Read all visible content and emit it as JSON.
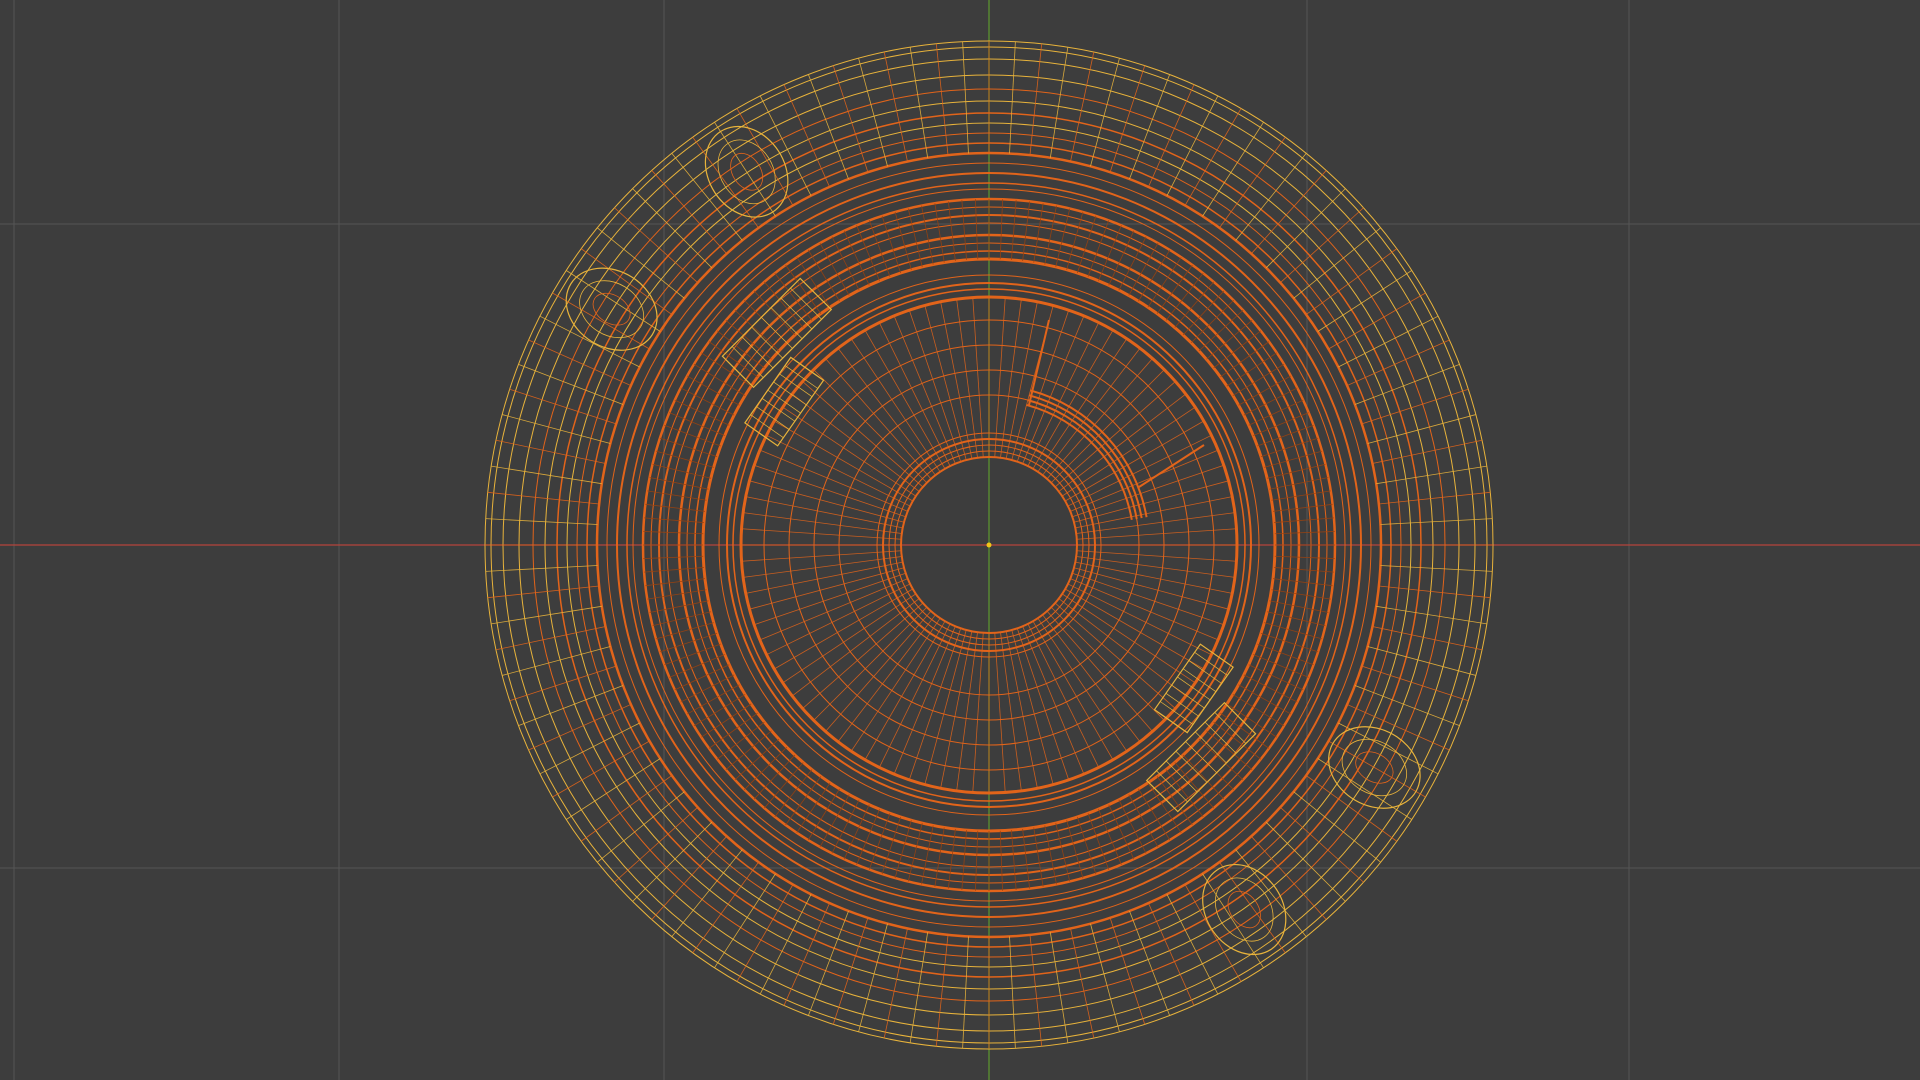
{
  "viewport": {
    "background": "#3d3d3d",
    "grid_color": "#555555",
    "x_axis_color": "#b5443c",
    "y_axis_color": "#5d9a2e",
    "origin_color": "#f0c419"
  },
  "object": {
    "display": "wireframe",
    "selected": true,
    "active_outline_color": "#e8b33b",
    "selected_wire_color": "#e2641a",
    "dark_wire_color": "#9a4210"
  }
}
